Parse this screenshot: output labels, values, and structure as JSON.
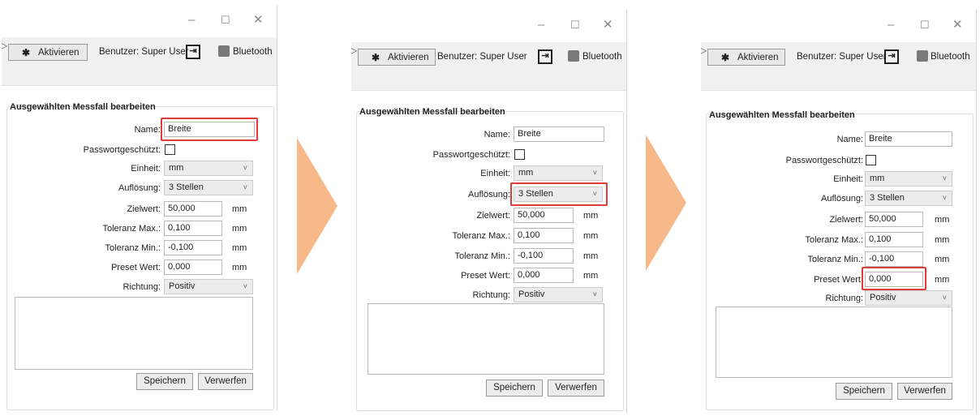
{
  "window": {
    "minimize_glyph": "–",
    "maximize_glyph": "☐",
    "close_glyph": "✕"
  },
  "toolbar": {
    "bluetooth_glyph": "✱",
    "activate_label": "Aktivieren",
    "user_text": "Benutzer: Super User",
    "logout_glyph": "⇥",
    "bluetooth_label": "Bluetooth"
  },
  "form": {
    "group_title": "Ausgewählten Messfall bearbeiten",
    "labels": {
      "name": "Name:",
      "password": "Passwortgeschützt:",
      "unit": "Einheit:",
      "resolution": "Auflösung:",
      "target": "Zielwert:",
      "tol_max": "Toleranz Max.:",
      "tol_min": "Toleranz Min.:",
      "preset": "Preset Wert:",
      "direction": "Richtung:"
    },
    "values": {
      "name": "Breite",
      "unit": "mm",
      "resolution": "3 Stellen",
      "target": "50,000",
      "tol_max": "0,100",
      "tol_min": "-0,100",
      "preset": "0,000",
      "direction": "Positiv"
    },
    "unit_suffix": "mm",
    "chevron": "˅",
    "save_label": "Speichern",
    "discard_label": "Verwerfen"
  },
  "colors": {
    "highlight": "#e03c3c",
    "arrow": "#f7b98a"
  }
}
